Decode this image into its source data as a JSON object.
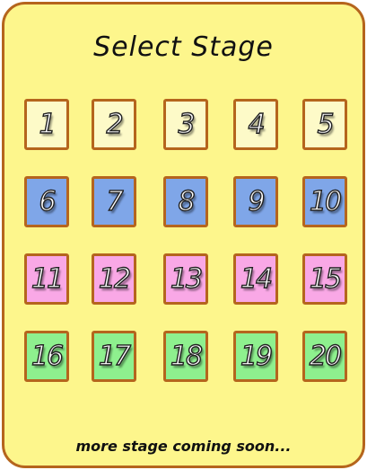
{
  "title": "Select Stage",
  "footer": "more stage coming soon...",
  "colors": {
    "background": "#fdf68c",
    "border": "#b5651d",
    "row1": "#fdfac8",
    "row2": "#7fa6e8",
    "row3": "#f9a8e6",
    "row4": "#8ef08e"
  },
  "stages": [
    {
      "label": "1",
      "row": 1
    },
    {
      "label": "2",
      "row": 1
    },
    {
      "label": "3",
      "row": 1
    },
    {
      "label": "4",
      "row": 1
    },
    {
      "label": "5",
      "row": 1
    },
    {
      "label": "6",
      "row": 2
    },
    {
      "label": "7",
      "row": 2
    },
    {
      "label": "8",
      "row": 2
    },
    {
      "label": "9",
      "row": 2
    },
    {
      "label": "10",
      "row": 2
    },
    {
      "label": "11",
      "row": 3
    },
    {
      "label": "12",
      "row": 3
    },
    {
      "label": "13",
      "row": 3
    },
    {
      "label": "14",
      "row": 3
    },
    {
      "label": "15",
      "row": 3
    },
    {
      "label": "16",
      "row": 4
    },
    {
      "label": "17",
      "row": 4
    },
    {
      "label": "18",
      "row": 4
    },
    {
      "label": "19",
      "row": 4
    },
    {
      "label": "20",
      "row": 4
    }
  ]
}
